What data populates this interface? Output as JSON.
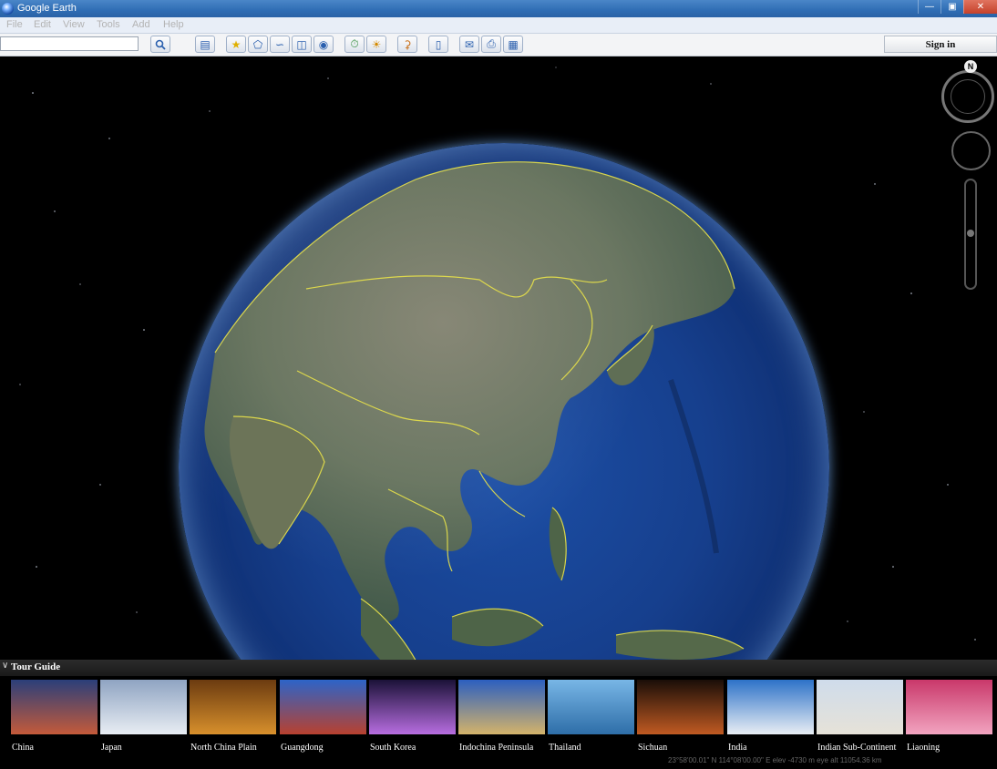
{
  "window": {
    "title": "Google Earth"
  },
  "menu": [
    "File",
    "Edit",
    "View",
    "Tools",
    "Add",
    "Help"
  ],
  "toolbar": {
    "search_placeholder": "",
    "search_icon": "magnifier-icon",
    "buttons": [
      {
        "icon": "sidebar-toggle-icon"
      },
      {
        "icon": "add-placemark-icon"
      },
      {
        "icon": "add-polygon-icon"
      },
      {
        "icon": "add-path-icon"
      },
      {
        "icon": "add-image-overlay-icon"
      },
      {
        "icon": "record-tour-icon"
      },
      {
        "icon": "historical-imagery-icon"
      },
      {
        "icon": "sunlight-icon"
      },
      {
        "icon": "switch-to-sky-icon"
      },
      {
        "icon": "ruler-icon"
      },
      {
        "icon": "email-icon"
      },
      {
        "icon": "print-icon"
      },
      {
        "icon": "save-image-icon"
      }
    ],
    "sign_in_label": "Sign in"
  },
  "navigation": {
    "north_label": "N"
  },
  "tour_guide": {
    "title": "Tour Guide",
    "items": [
      {
        "label": "China",
        "colors": [
          "#2b3f7a",
          "#c45a3a"
        ]
      },
      {
        "label": "Japan",
        "colors": [
          "#8fa4c2",
          "#e8edf3"
        ]
      },
      {
        "label": "North China Plain",
        "colors": [
          "#6b3b10",
          "#d8902c"
        ]
      },
      {
        "label": "Guangdong",
        "colors": [
          "#2d64c8",
          "#b8412f"
        ]
      },
      {
        "label": "South Korea",
        "colors": [
          "#1b1238",
          "#b76de0"
        ]
      },
      {
        "label": "Indochina Peninsula",
        "colors": [
          "#2c5fc0",
          "#d4b36a"
        ]
      },
      {
        "label": "Thailand",
        "colors": [
          "#78b6e6",
          "#2e6ea8"
        ]
      },
      {
        "label": "Sichuan",
        "colors": [
          "#1a0e08",
          "#c05a22"
        ]
      },
      {
        "label": "India",
        "colors": [
          "#2d72c8",
          "#e9eef4"
        ]
      },
      {
        "label": "Indian Sub-Continent",
        "colors": [
          "#cfdceb",
          "#e6e2d8"
        ]
      },
      {
        "label": "Liaoning",
        "colors": [
          "#c9386a",
          "#f2a4c0"
        ]
      }
    ]
  },
  "status": {
    "text": "23°58'00.01\" N 114°08'00.00\" E  elev -4730 m     eye alt 11054.36 km"
  }
}
